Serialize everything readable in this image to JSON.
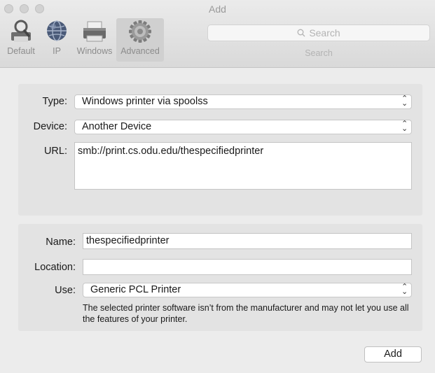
{
  "window": {
    "title": "Add"
  },
  "toolbar": {
    "items": [
      {
        "label": "Default",
        "icon": "default-printer-icon",
        "selected": false
      },
      {
        "label": "IP",
        "icon": "globe-icon",
        "selected": false
      },
      {
        "label": "Windows",
        "icon": "windows-printer-icon",
        "selected": false
      },
      {
        "label": "Advanced",
        "icon": "gear-icon",
        "selected": true
      }
    ],
    "search_placeholder": "Search",
    "search_label": "Search"
  },
  "connection": {
    "type_label": "Type:",
    "type_value": "Windows printer via spoolss",
    "device_label": "Device:",
    "device_value": "Another Device",
    "url_label": "URL:",
    "url_value": "smb://print.cs.odu.edu/thespecifiedprinter"
  },
  "details": {
    "name_label": "Name:",
    "name_value": "thespecifiedprinter",
    "location_label": "Location:",
    "location_value": "",
    "use_label": "Use:",
    "use_value": "Generic PCL Printer",
    "note": "The selected printer software isn’t from the manufacturer and may not let you use all the features of your printer."
  },
  "actions": {
    "add_label": "Add"
  }
}
